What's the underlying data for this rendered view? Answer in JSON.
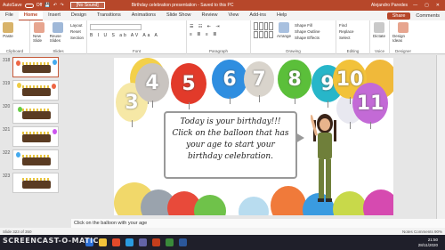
{
  "titlebar": {
    "autosave": "AutoSave",
    "autosave_state": "Off",
    "file_name": "[No Sound]",
    "doc_title": "Birthday celebration presentation - Saved to this PC",
    "user": "Alejandro Paredes"
  },
  "tabs": [
    "File",
    "Home",
    "Insert",
    "Design",
    "Transitions",
    "Animations",
    "Slide Show",
    "Review",
    "View",
    "Add-ins",
    "Help"
  ],
  "tabs_right": {
    "share": "Share",
    "comments": "Comments"
  },
  "ribbon": {
    "clipboard": {
      "paste": "Paste",
      "label": "Clipboard"
    },
    "slides": {
      "new_slide": "New Slide",
      "reuse": "Reuse Slides",
      "layout": "Layout",
      "reset": "Reset",
      "section": "Section",
      "label": "Slides"
    },
    "font": {
      "format_row": "B I U S ab AV Aa A",
      "label": "Font"
    },
    "paragraph": {
      "label": "Paragraph"
    },
    "drawing": {
      "shapes": "Shapes",
      "arrange": "Arrange",
      "quick": "Quick Styles",
      "fill": "Shape Fill",
      "outline": "Shape Outline",
      "effects": "Shape Effects",
      "label": "Drawing"
    },
    "editing": {
      "find": "Find",
      "replace": "Replace",
      "select": "Select",
      "label": "Editing"
    },
    "voice": {
      "dictate": "Dictate",
      "label": "Voice"
    },
    "designer": {
      "design_ideas": "Design Ideas",
      "label": "Designer"
    }
  },
  "slides_panel": [
    "318",
    "319",
    "320",
    "321",
    "322",
    "323"
  ],
  "slide": {
    "balloons": [
      "3",
      "4",
      "5",
      "6",
      "7",
      "8",
      "9",
      "10",
      "11"
    ],
    "message": "Today is your birthday!!! Click on the balloon that has your age to start your birthday celebration."
  },
  "notes": "Click on the balloon with your age",
  "status": {
    "left": "Slide 323 of 350",
    "right": "Notes   Comments   90%"
  },
  "taskbar": {
    "time": "21:50",
    "date": "28/11/2020",
    "lang": "ESP"
  },
  "watermark": "SCREENCAST-O-MATIC",
  "colors": {
    "accent": "#b7472a"
  }
}
